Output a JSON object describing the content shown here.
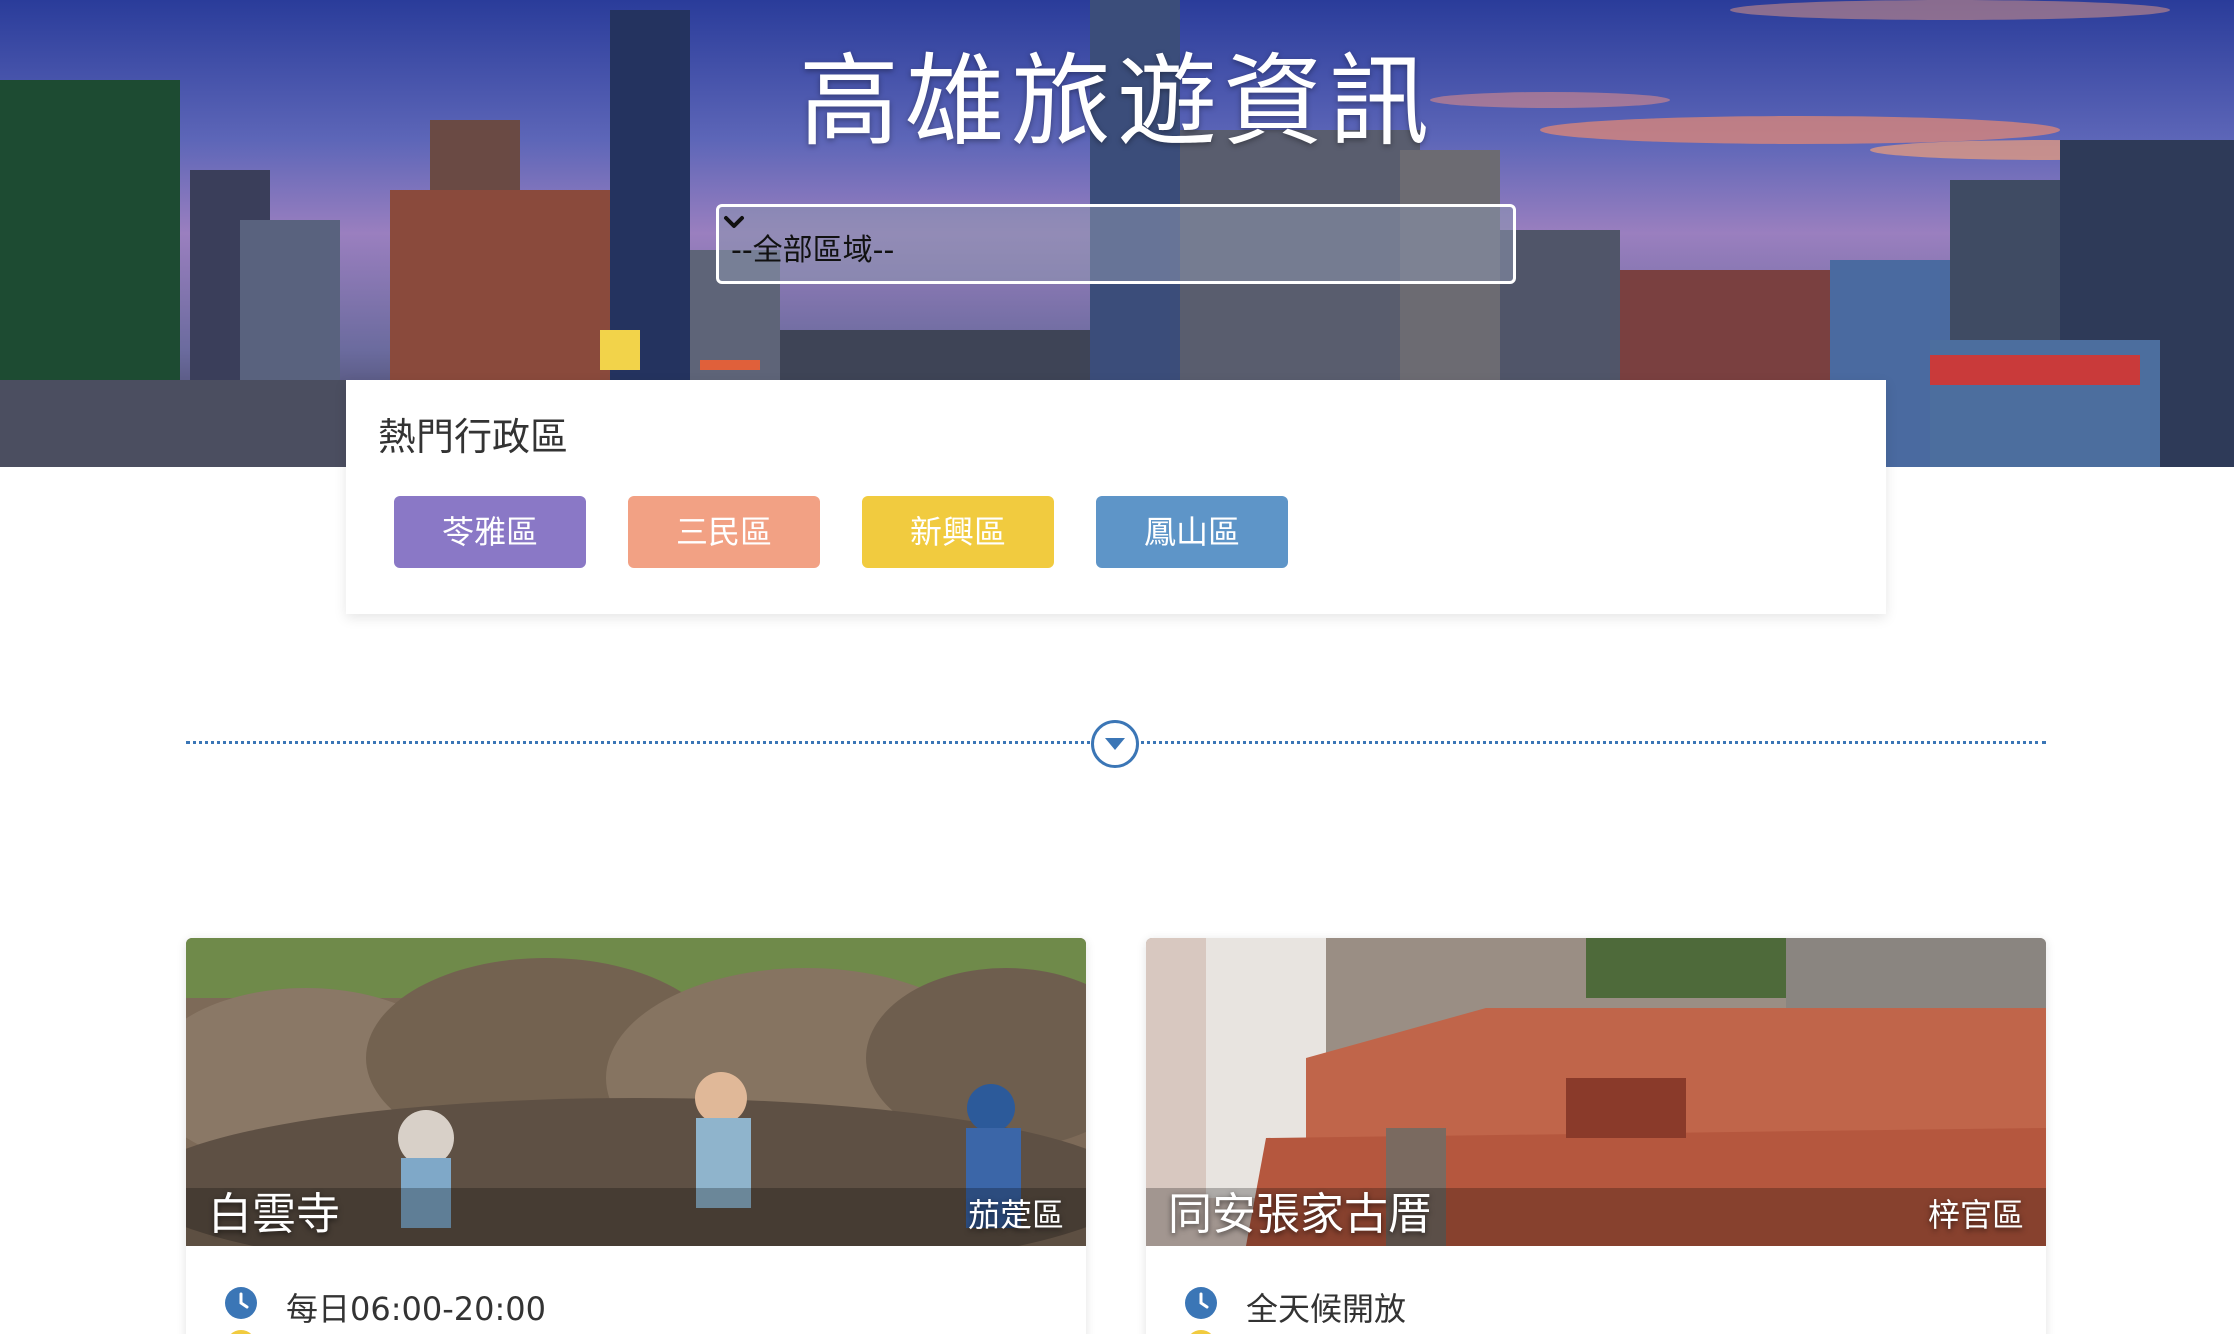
{
  "hero": {
    "title": "高雄旅遊資訊"
  },
  "area_select": {
    "value": "--全部區域--"
  },
  "hot_districts": {
    "title": "熱門行政區",
    "buttons": [
      {
        "label": "苓雅區",
        "color": "#8a78c6"
      },
      {
        "label": "三民區",
        "color": "#f2a184"
      },
      {
        "label": "新興區",
        "color": "#f1cb3f"
      },
      {
        "label": "鳳山區",
        "color": "#5e95c8"
      }
    ]
  },
  "cards": [
    {
      "name": "白雲寺",
      "district": "茄萣區",
      "hours": "每日06:00-20:00"
    },
    {
      "name": "同安張家古厝",
      "district": "梓官區",
      "hours": "全天候開放"
    }
  ],
  "colors": {
    "accent_blue": "#3b76b6",
    "clock_icon": "#3b76b6",
    "address_icon": "#f1cb3f"
  }
}
